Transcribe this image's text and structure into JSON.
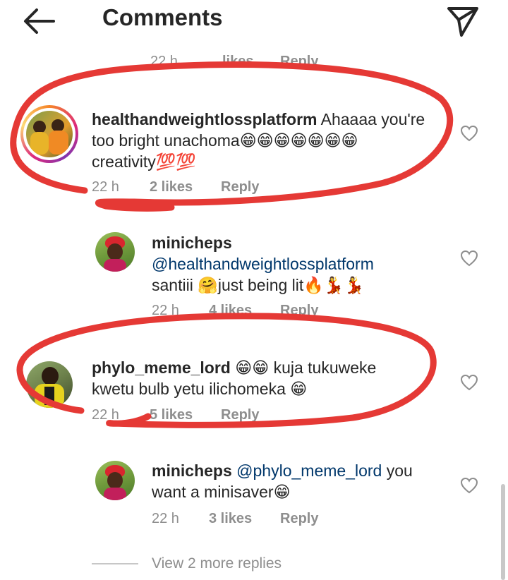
{
  "header": {
    "title": "Comments"
  },
  "partial_top": {
    "time": "22 h",
    "likes": "likes",
    "reply": "Reply"
  },
  "comments": [
    {
      "username": "healthandweightlossplatform",
      "text_line1": " Ahaaaa you're",
      "text_line2": "too bright unachoma😁😁😁😁😁😁😁",
      "text_line3": "creativity💯💯",
      "time": "22 h",
      "likes": "2 likes",
      "reply": "Reply"
    },
    {
      "username": "minicheps",
      "mention": "@healthandweightlossplatform",
      "text": "santiii 🤗just being lit🔥💃💃",
      "time": "22 h",
      "likes": "4 likes",
      "reply": "Reply"
    },
    {
      "username": "phylo_meme_lord",
      "text_line1": " 😁😁 kuja tukuweke",
      "text_line2": "kwetu bulb yetu ilichomeka 😁",
      "time": "22 h",
      "likes": "5 likes",
      "reply": "Reply"
    },
    {
      "username": "minicheps",
      "mention": " @phylo_meme_lord",
      "text_tail": " you",
      "text_line2": "want a minisaver😁",
      "time": "22 h",
      "likes": "3 likes",
      "reply": "Reply"
    }
  ],
  "view_more": "View 2 more replies",
  "colors": {
    "text": "#262626",
    "secondary": "#8e8e8e",
    "mention": "#00376b",
    "annotation": "#e53935"
  }
}
